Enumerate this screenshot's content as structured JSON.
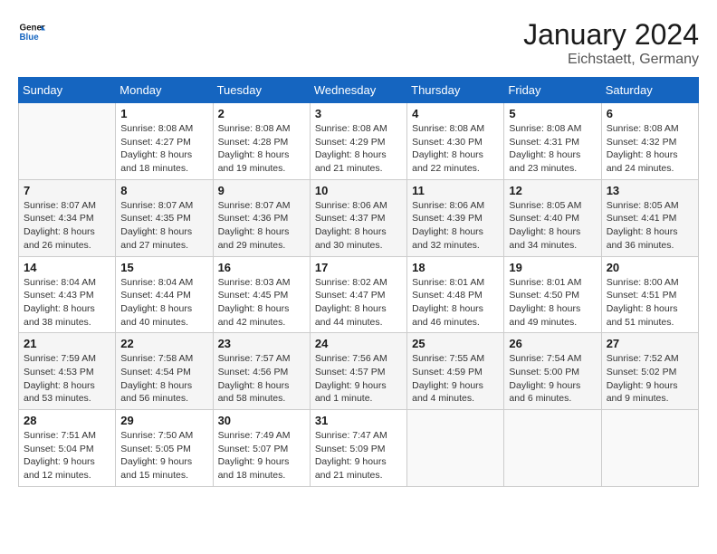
{
  "header": {
    "logo_line1": "General",
    "logo_line2": "Blue",
    "month": "January 2024",
    "location": "Eichstaett, Germany"
  },
  "weekdays": [
    "Sunday",
    "Monday",
    "Tuesday",
    "Wednesday",
    "Thursday",
    "Friday",
    "Saturday"
  ],
  "weeks": [
    [
      {
        "day": "",
        "info": ""
      },
      {
        "day": "1",
        "info": "Sunrise: 8:08 AM\nSunset: 4:27 PM\nDaylight: 8 hours\nand 18 minutes."
      },
      {
        "day": "2",
        "info": "Sunrise: 8:08 AM\nSunset: 4:28 PM\nDaylight: 8 hours\nand 19 minutes."
      },
      {
        "day": "3",
        "info": "Sunrise: 8:08 AM\nSunset: 4:29 PM\nDaylight: 8 hours\nand 21 minutes."
      },
      {
        "day": "4",
        "info": "Sunrise: 8:08 AM\nSunset: 4:30 PM\nDaylight: 8 hours\nand 22 minutes."
      },
      {
        "day": "5",
        "info": "Sunrise: 8:08 AM\nSunset: 4:31 PM\nDaylight: 8 hours\nand 23 minutes."
      },
      {
        "day": "6",
        "info": "Sunrise: 8:08 AM\nSunset: 4:32 PM\nDaylight: 8 hours\nand 24 minutes."
      }
    ],
    [
      {
        "day": "7",
        "info": "Sunrise: 8:07 AM\nSunset: 4:34 PM\nDaylight: 8 hours\nand 26 minutes."
      },
      {
        "day": "8",
        "info": "Sunrise: 8:07 AM\nSunset: 4:35 PM\nDaylight: 8 hours\nand 27 minutes."
      },
      {
        "day": "9",
        "info": "Sunrise: 8:07 AM\nSunset: 4:36 PM\nDaylight: 8 hours\nand 29 minutes."
      },
      {
        "day": "10",
        "info": "Sunrise: 8:06 AM\nSunset: 4:37 PM\nDaylight: 8 hours\nand 30 minutes."
      },
      {
        "day": "11",
        "info": "Sunrise: 8:06 AM\nSunset: 4:39 PM\nDaylight: 8 hours\nand 32 minutes."
      },
      {
        "day": "12",
        "info": "Sunrise: 8:05 AM\nSunset: 4:40 PM\nDaylight: 8 hours\nand 34 minutes."
      },
      {
        "day": "13",
        "info": "Sunrise: 8:05 AM\nSunset: 4:41 PM\nDaylight: 8 hours\nand 36 minutes."
      }
    ],
    [
      {
        "day": "14",
        "info": "Sunrise: 8:04 AM\nSunset: 4:43 PM\nDaylight: 8 hours\nand 38 minutes."
      },
      {
        "day": "15",
        "info": "Sunrise: 8:04 AM\nSunset: 4:44 PM\nDaylight: 8 hours\nand 40 minutes."
      },
      {
        "day": "16",
        "info": "Sunrise: 8:03 AM\nSunset: 4:45 PM\nDaylight: 8 hours\nand 42 minutes."
      },
      {
        "day": "17",
        "info": "Sunrise: 8:02 AM\nSunset: 4:47 PM\nDaylight: 8 hours\nand 44 minutes."
      },
      {
        "day": "18",
        "info": "Sunrise: 8:01 AM\nSunset: 4:48 PM\nDaylight: 8 hours\nand 46 minutes."
      },
      {
        "day": "19",
        "info": "Sunrise: 8:01 AM\nSunset: 4:50 PM\nDaylight: 8 hours\nand 49 minutes."
      },
      {
        "day": "20",
        "info": "Sunrise: 8:00 AM\nSunset: 4:51 PM\nDaylight: 8 hours\nand 51 minutes."
      }
    ],
    [
      {
        "day": "21",
        "info": "Sunrise: 7:59 AM\nSunset: 4:53 PM\nDaylight: 8 hours\nand 53 minutes."
      },
      {
        "day": "22",
        "info": "Sunrise: 7:58 AM\nSunset: 4:54 PM\nDaylight: 8 hours\nand 56 minutes."
      },
      {
        "day": "23",
        "info": "Sunrise: 7:57 AM\nSunset: 4:56 PM\nDaylight: 8 hours\nand 58 minutes."
      },
      {
        "day": "24",
        "info": "Sunrise: 7:56 AM\nSunset: 4:57 PM\nDaylight: 9 hours\nand 1 minute."
      },
      {
        "day": "25",
        "info": "Sunrise: 7:55 AM\nSunset: 4:59 PM\nDaylight: 9 hours\nand 4 minutes."
      },
      {
        "day": "26",
        "info": "Sunrise: 7:54 AM\nSunset: 5:00 PM\nDaylight: 9 hours\nand 6 minutes."
      },
      {
        "day": "27",
        "info": "Sunrise: 7:52 AM\nSunset: 5:02 PM\nDaylight: 9 hours\nand 9 minutes."
      }
    ],
    [
      {
        "day": "28",
        "info": "Sunrise: 7:51 AM\nSunset: 5:04 PM\nDaylight: 9 hours\nand 12 minutes."
      },
      {
        "day": "29",
        "info": "Sunrise: 7:50 AM\nSunset: 5:05 PM\nDaylight: 9 hours\nand 15 minutes."
      },
      {
        "day": "30",
        "info": "Sunrise: 7:49 AM\nSunset: 5:07 PM\nDaylight: 9 hours\nand 18 minutes."
      },
      {
        "day": "31",
        "info": "Sunrise: 7:47 AM\nSunset: 5:09 PM\nDaylight: 9 hours\nand 21 minutes."
      },
      {
        "day": "",
        "info": ""
      },
      {
        "day": "",
        "info": ""
      },
      {
        "day": "",
        "info": ""
      }
    ]
  ]
}
